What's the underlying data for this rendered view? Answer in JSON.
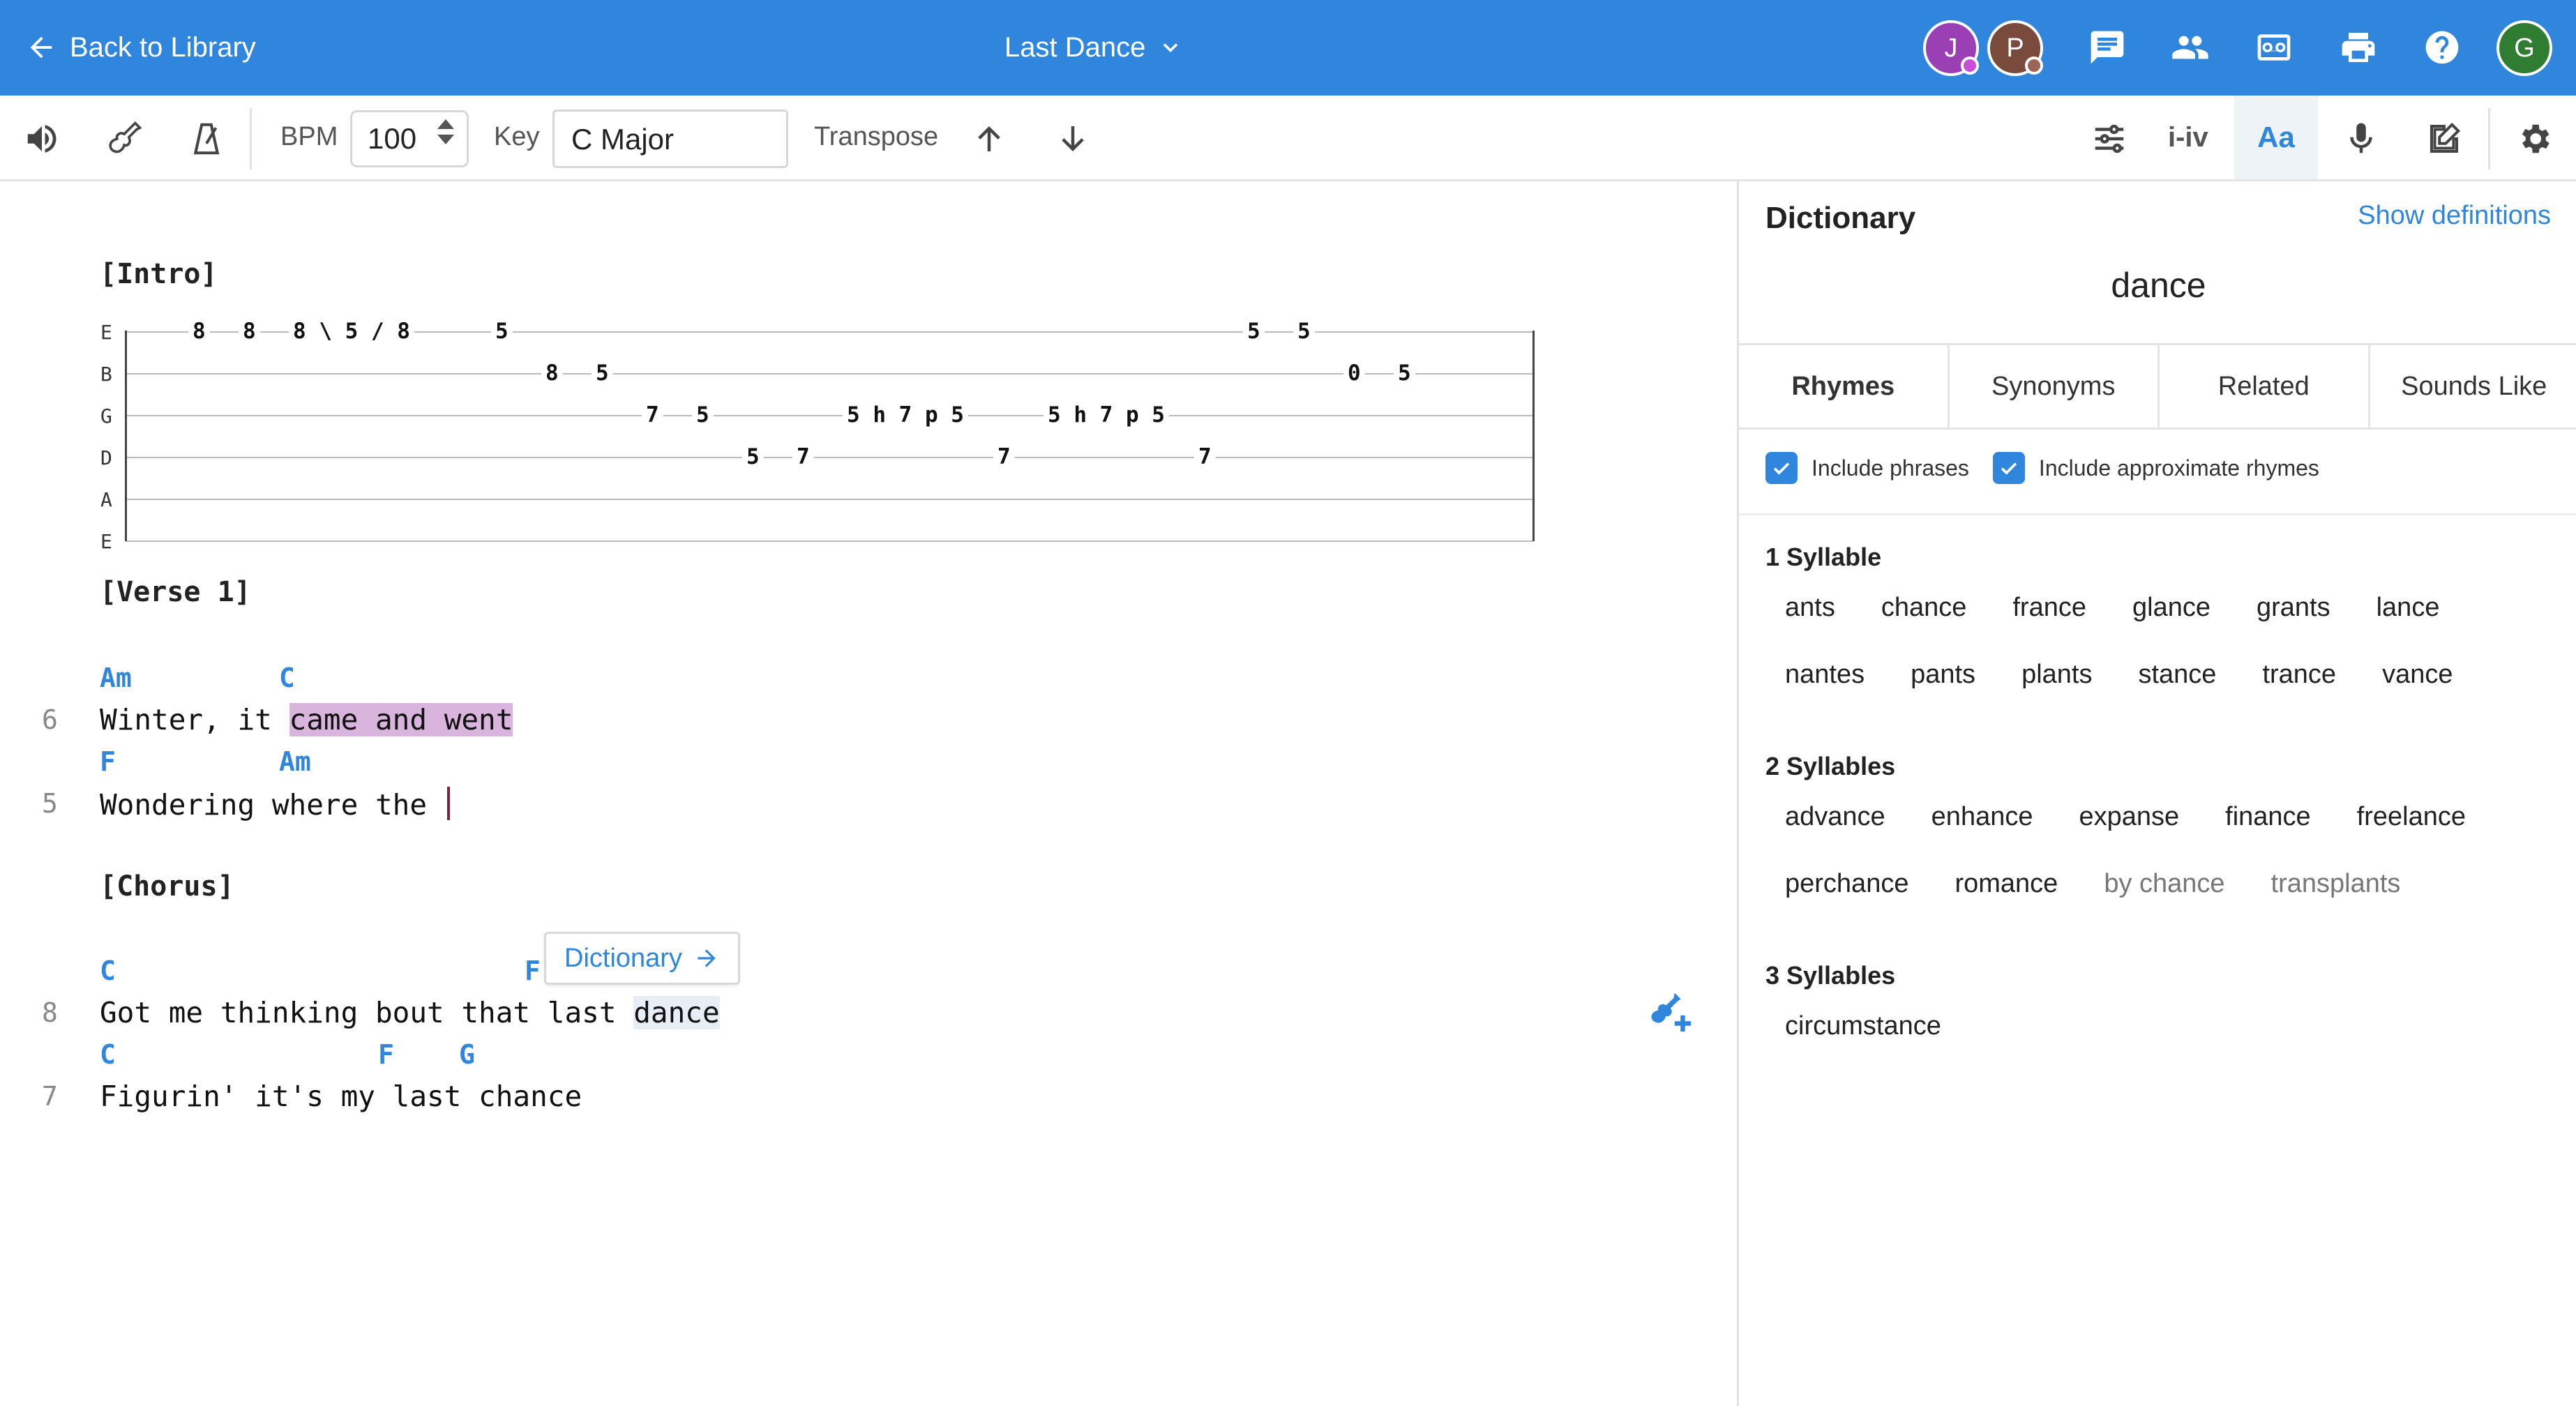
{
  "header": {
    "back_label": "Back to Library",
    "song_title": "Last Dance",
    "avatars": [
      {
        "initial": "J",
        "color": "#9b3fb5",
        "status_color": "#c74fd9"
      },
      {
        "initial": "P",
        "color": "#7a4a3c",
        "status_color": "#9b6657"
      },
      {
        "initial": "G",
        "color": "#2e7d32"
      }
    ],
    "icons": [
      "comments-icon",
      "collaborators-icon",
      "voicemail-icon",
      "print-icon",
      "help-icon"
    ]
  },
  "toolbar": {
    "bpm_label": "BPM",
    "bpm_value": "100",
    "key_label": "Key",
    "key_value": "C Major",
    "transpose_label": "Transpose",
    "chord_mode_label": "i-iv",
    "font_label": "Aa"
  },
  "editor": {
    "sections": {
      "intro": "[Intro]",
      "verse1": "[Verse 1]",
      "chorus": "[Chorus]"
    },
    "tab": {
      "strings": [
        "E",
        "B",
        "G",
        "D",
        "A",
        "E"
      ],
      "frets": [
        {
          "string": 0,
          "text": "8"
        },
        {
          "string": 0,
          "text": "8"
        },
        {
          "string": 0,
          "text": "8 \\ 5 / 8"
        },
        {
          "string": 0,
          "text": "5"
        },
        {
          "string": 0,
          "text": "5"
        },
        {
          "string": 0,
          "text": "5"
        },
        {
          "string": 1,
          "text": "8"
        },
        {
          "string": 1,
          "text": "5"
        },
        {
          "string": 1,
          "text": "0"
        },
        {
          "string": 1,
          "text": "5"
        },
        {
          "string": 2,
          "text": "7"
        },
        {
          "string": 2,
          "text": "5"
        },
        {
          "string": 2,
          "text": "5 h 7 p 5"
        },
        {
          "string": 2,
          "text": "5 h 7 p 5"
        },
        {
          "string": 3,
          "text": "5"
        },
        {
          "string": 3,
          "text": "7"
        },
        {
          "string": 3,
          "text": "7"
        },
        {
          "string": 3,
          "text": "7"
        }
      ]
    },
    "lines": [
      {
        "num": "6",
        "chords": [
          "Am",
          "C"
        ],
        "pre": "Winter, it ",
        "sel": "came and went"
      },
      {
        "num": "5",
        "chords": [
          "F",
          "Am"
        ],
        "text": "Wondering where the "
      },
      {
        "num": "8",
        "chords": [
          "C",
          "F"
        ],
        "pre": "Got me thinking bout that last ",
        "word": "dance"
      },
      {
        "num": "7",
        "chords": [
          "C",
          "F",
          "G"
        ],
        "text": "Figurin' it's my last chance"
      }
    ],
    "dict_popup_label": "Dictionary"
  },
  "dictionary": {
    "title": "Dictionary",
    "show_definitions": "Show definitions",
    "word": "dance",
    "tabs": [
      "Rhymes",
      "Synonyms",
      "Related",
      "Sounds Like"
    ],
    "include_phrases": "Include phrases",
    "include_approx": "Include approximate rhymes",
    "groups": [
      {
        "heading": "1 Syllable",
        "rows": [
          [
            "ants",
            "chance",
            "france",
            "glance",
            "grants",
            "lance"
          ],
          [
            "nantes",
            "pants",
            "plants",
            "stance",
            "trance",
            "vance"
          ]
        ]
      },
      {
        "heading": "2 Syllables",
        "rows": [
          [
            "advance",
            "enhance",
            "expanse",
            "finance",
            "freelance"
          ],
          [
            "perchance",
            "romance",
            "by chance",
            "transplants"
          ]
        ]
      },
      {
        "heading": "3 Syllables",
        "rows": [
          [
            "circumstance"
          ]
        ]
      }
    ],
    "dim_words": [
      "by chance",
      "transplants"
    ]
  },
  "colors": {
    "accent": "#2f86dc",
    "selection": "#d9b4dc",
    "cursor": "#7a2540"
  }
}
